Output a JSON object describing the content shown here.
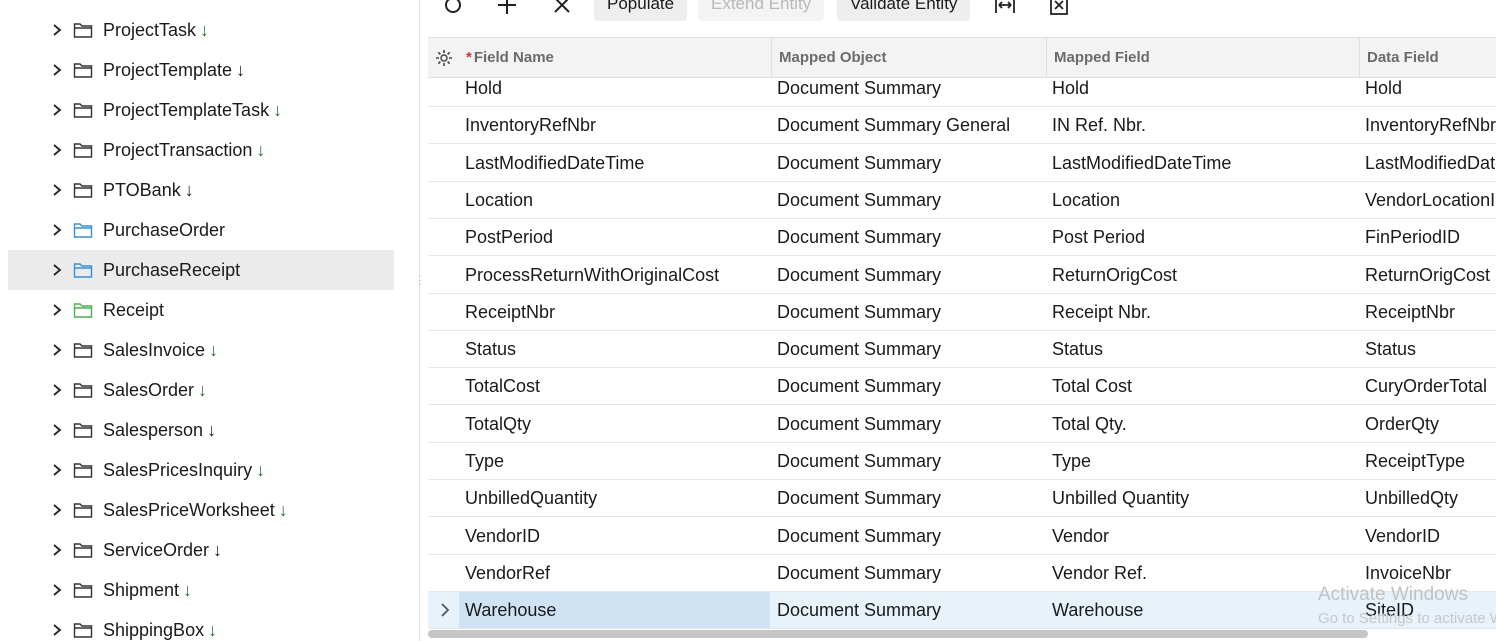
{
  "tree": {
    "items": [
      {
        "label": "ProjectTask",
        "arrow": "↓",
        "folder": "default"
      },
      {
        "label": "ProjectTemplate",
        "arrow": "↓",
        "folder": "default"
      },
      {
        "label": "ProjectTemplateTask",
        "arrow": "↓",
        "folder": "default"
      },
      {
        "label": "ProjectTransaction",
        "arrow": "↓",
        "folder": "default"
      },
      {
        "label": "PTOBank",
        "arrow": "↓",
        "folder": "default"
      },
      {
        "label": "PurchaseOrder",
        "arrow": "",
        "folder": "blue"
      },
      {
        "label": "PurchaseReceipt",
        "arrow": "",
        "folder": "blue",
        "selected": true
      },
      {
        "label": "Receipt",
        "arrow": "",
        "folder": "green"
      },
      {
        "label": "SalesInvoice",
        "arrow": "↓",
        "folder": "default"
      },
      {
        "label": "SalesOrder",
        "arrow": "↓",
        "folder": "default"
      },
      {
        "label": "Salesperson",
        "arrow": "↓",
        "folder": "default"
      },
      {
        "label": "SalesPricesInquiry",
        "arrow": "↓",
        "folder": "default"
      },
      {
        "label": "SalesPriceWorksheet",
        "arrow": "↓",
        "folder": "default"
      },
      {
        "label": "ServiceOrder",
        "arrow": "↓",
        "folder": "default"
      },
      {
        "label": "Shipment",
        "arrow": "↓",
        "folder": "default"
      },
      {
        "label": "ShippingBox",
        "arrow": "↓",
        "folder": "default"
      }
    ]
  },
  "toolbar": {
    "populate_label": "Populate",
    "extend_entity_label": "Extend Entity",
    "validate_entity_label": "Validate Entity",
    "icons": [
      "refresh-icon",
      "add-icon",
      "delete-icon",
      "fit-width-icon",
      "excel-export-icon"
    ]
  },
  "grid": {
    "required_marker": "*",
    "columns": [
      "Field Name",
      "Mapped Object",
      "Mapped Field",
      "Data Field"
    ],
    "rows": [
      [
        "Hold",
        "Document Summary",
        "Hold",
        "Hold"
      ],
      [
        "InventoryRefNbr",
        "Document Summary General",
        "IN Ref. Nbr.",
        "InventoryRefNbr"
      ],
      [
        "LastModifiedDateTime",
        "Document Summary",
        "LastModifiedDateTime",
        "LastModifiedDateTime"
      ],
      [
        "Location",
        "Document Summary",
        "Location",
        "VendorLocationID"
      ],
      [
        "PostPeriod",
        "Document Summary",
        "Post Period",
        "FinPeriodID"
      ],
      [
        "ProcessReturnWithOriginalCost",
        "Document Summary",
        "ReturnOrigCost",
        "ReturnOrigCost"
      ],
      [
        "ReceiptNbr",
        "Document Summary",
        "Receipt Nbr.",
        "ReceiptNbr"
      ],
      [
        "Status",
        "Document Summary",
        "Status",
        "Status"
      ],
      [
        "TotalCost",
        "Document Summary",
        "Total Cost",
        "CuryOrderTotal"
      ],
      [
        "TotalQty",
        "Document Summary",
        "Total Qty.",
        "OrderQty"
      ],
      [
        "Type",
        "Document Summary",
        "Type",
        "ReceiptType"
      ],
      [
        "UnbilledQuantity",
        "Document Summary",
        "Unbilled Quantity",
        "UnbilledQty"
      ],
      [
        "VendorID",
        "Document Summary",
        "Vendor",
        "VendorID"
      ],
      [
        "VendorRef",
        "Document Summary",
        "Vendor Ref.",
        "InvoiceNbr"
      ],
      [
        "Warehouse",
        "Document Summary",
        "Warehouse",
        "SiteID"
      ]
    ],
    "active_row_index": 14
  },
  "watermark": {
    "line1": "Activate Windows",
    "line2": "Go to Settings to activate Windows."
  },
  "colors": {
    "selected_row": "#ebebeb",
    "active_grid_row": "#e8f2fb",
    "active_cell": "#cfe3f5",
    "folder_blue": "#3a8fd6",
    "folder_green": "#4caf50",
    "required": "#d0312d",
    "arrow_green": "#2f6b2f"
  }
}
